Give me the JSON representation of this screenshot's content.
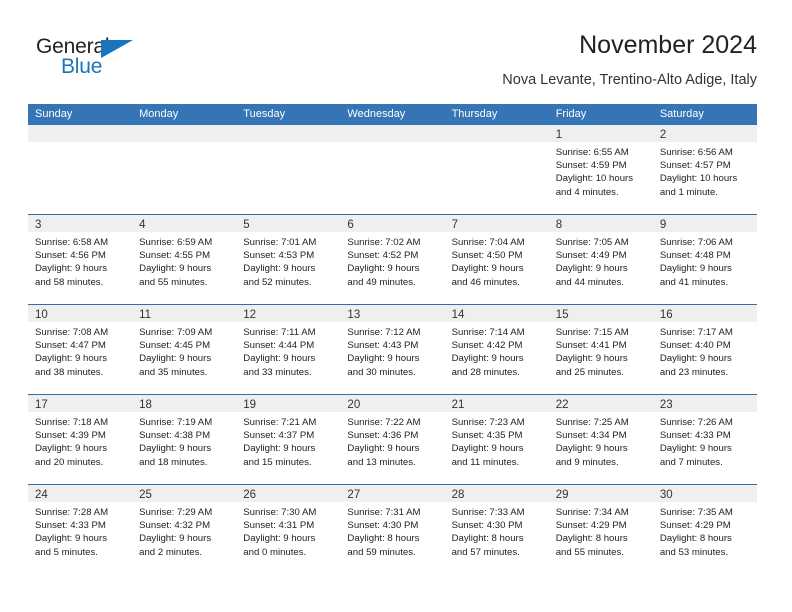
{
  "logo": {
    "word_one": "General",
    "word_two": "Blue",
    "triangle_color": "#1b75bc"
  },
  "header": {
    "title": "November 2024",
    "subtitle": "Nova Levante, Trentino-Alto Adige, Italy"
  },
  "theme": {
    "header_blue": "#3575b5",
    "row_divider_blue": "#2e6da8",
    "day_band_gray": "#efefef"
  },
  "weekdays": [
    "Sunday",
    "Monday",
    "Tuesday",
    "Wednesday",
    "Thursday",
    "Friday",
    "Saturday"
  ],
  "weeks": [
    [
      {
        "day": "",
        "empty": true,
        "sunrise": "",
        "sunset": "",
        "daylight_1": "",
        "daylight_2": ""
      },
      {
        "day": "",
        "empty": true,
        "sunrise": "",
        "sunset": "",
        "daylight_1": "",
        "daylight_2": ""
      },
      {
        "day": "",
        "empty": true,
        "sunrise": "",
        "sunset": "",
        "daylight_1": "",
        "daylight_2": ""
      },
      {
        "day": "",
        "empty": true,
        "sunrise": "",
        "sunset": "",
        "daylight_1": "",
        "daylight_2": ""
      },
      {
        "day": "",
        "empty": true,
        "sunrise": "",
        "sunset": "",
        "daylight_1": "",
        "daylight_2": ""
      },
      {
        "day": "1",
        "empty": false,
        "sunrise": "Sunrise: 6:55 AM",
        "sunset": "Sunset: 4:59 PM",
        "daylight_1": "Daylight: 10 hours",
        "daylight_2": "and 4 minutes."
      },
      {
        "day": "2",
        "empty": false,
        "sunrise": "Sunrise: 6:56 AM",
        "sunset": "Sunset: 4:57 PM",
        "daylight_1": "Daylight: 10 hours",
        "daylight_2": "and 1 minute."
      }
    ],
    [
      {
        "day": "3",
        "empty": false,
        "sunrise": "Sunrise: 6:58 AM",
        "sunset": "Sunset: 4:56 PM",
        "daylight_1": "Daylight: 9 hours",
        "daylight_2": "and 58 minutes."
      },
      {
        "day": "4",
        "empty": false,
        "sunrise": "Sunrise: 6:59 AM",
        "sunset": "Sunset: 4:55 PM",
        "daylight_1": "Daylight: 9 hours",
        "daylight_2": "and 55 minutes."
      },
      {
        "day": "5",
        "empty": false,
        "sunrise": "Sunrise: 7:01 AM",
        "sunset": "Sunset: 4:53 PM",
        "daylight_1": "Daylight: 9 hours",
        "daylight_2": "and 52 minutes."
      },
      {
        "day": "6",
        "empty": false,
        "sunrise": "Sunrise: 7:02 AM",
        "sunset": "Sunset: 4:52 PM",
        "daylight_1": "Daylight: 9 hours",
        "daylight_2": "and 49 minutes."
      },
      {
        "day": "7",
        "empty": false,
        "sunrise": "Sunrise: 7:04 AM",
        "sunset": "Sunset: 4:50 PM",
        "daylight_1": "Daylight: 9 hours",
        "daylight_2": "and 46 minutes."
      },
      {
        "day": "8",
        "empty": false,
        "sunrise": "Sunrise: 7:05 AM",
        "sunset": "Sunset: 4:49 PM",
        "daylight_1": "Daylight: 9 hours",
        "daylight_2": "and 44 minutes."
      },
      {
        "day": "9",
        "empty": false,
        "sunrise": "Sunrise: 7:06 AM",
        "sunset": "Sunset: 4:48 PM",
        "daylight_1": "Daylight: 9 hours",
        "daylight_2": "and 41 minutes."
      }
    ],
    [
      {
        "day": "10",
        "empty": false,
        "sunrise": "Sunrise: 7:08 AM",
        "sunset": "Sunset: 4:47 PM",
        "daylight_1": "Daylight: 9 hours",
        "daylight_2": "and 38 minutes."
      },
      {
        "day": "11",
        "empty": false,
        "sunrise": "Sunrise: 7:09 AM",
        "sunset": "Sunset: 4:45 PM",
        "daylight_1": "Daylight: 9 hours",
        "daylight_2": "and 35 minutes."
      },
      {
        "day": "12",
        "empty": false,
        "sunrise": "Sunrise: 7:11 AM",
        "sunset": "Sunset: 4:44 PM",
        "daylight_1": "Daylight: 9 hours",
        "daylight_2": "and 33 minutes."
      },
      {
        "day": "13",
        "empty": false,
        "sunrise": "Sunrise: 7:12 AM",
        "sunset": "Sunset: 4:43 PM",
        "daylight_1": "Daylight: 9 hours",
        "daylight_2": "and 30 minutes."
      },
      {
        "day": "14",
        "empty": false,
        "sunrise": "Sunrise: 7:14 AM",
        "sunset": "Sunset: 4:42 PM",
        "daylight_1": "Daylight: 9 hours",
        "daylight_2": "and 28 minutes."
      },
      {
        "day": "15",
        "empty": false,
        "sunrise": "Sunrise: 7:15 AM",
        "sunset": "Sunset: 4:41 PM",
        "daylight_1": "Daylight: 9 hours",
        "daylight_2": "and 25 minutes."
      },
      {
        "day": "16",
        "empty": false,
        "sunrise": "Sunrise: 7:17 AM",
        "sunset": "Sunset: 4:40 PM",
        "daylight_1": "Daylight: 9 hours",
        "daylight_2": "and 23 minutes."
      }
    ],
    [
      {
        "day": "17",
        "empty": false,
        "sunrise": "Sunrise: 7:18 AM",
        "sunset": "Sunset: 4:39 PM",
        "daylight_1": "Daylight: 9 hours",
        "daylight_2": "and 20 minutes."
      },
      {
        "day": "18",
        "empty": false,
        "sunrise": "Sunrise: 7:19 AM",
        "sunset": "Sunset: 4:38 PM",
        "daylight_1": "Daylight: 9 hours",
        "daylight_2": "and 18 minutes."
      },
      {
        "day": "19",
        "empty": false,
        "sunrise": "Sunrise: 7:21 AM",
        "sunset": "Sunset: 4:37 PM",
        "daylight_1": "Daylight: 9 hours",
        "daylight_2": "and 15 minutes."
      },
      {
        "day": "20",
        "empty": false,
        "sunrise": "Sunrise: 7:22 AM",
        "sunset": "Sunset: 4:36 PM",
        "daylight_1": "Daylight: 9 hours",
        "daylight_2": "and 13 minutes."
      },
      {
        "day": "21",
        "empty": false,
        "sunrise": "Sunrise: 7:23 AM",
        "sunset": "Sunset: 4:35 PM",
        "daylight_1": "Daylight: 9 hours",
        "daylight_2": "and 11 minutes."
      },
      {
        "day": "22",
        "empty": false,
        "sunrise": "Sunrise: 7:25 AM",
        "sunset": "Sunset: 4:34 PM",
        "daylight_1": "Daylight: 9 hours",
        "daylight_2": "and 9 minutes."
      },
      {
        "day": "23",
        "empty": false,
        "sunrise": "Sunrise: 7:26 AM",
        "sunset": "Sunset: 4:33 PM",
        "daylight_1": "Daylight: 9 hours",
        "daylight_2": "and 7 minutes."
      }
    ],
    [
      {
        "day": "24",
        "empty": false,
        "sunrise": "Sunrise: 7:28 AM",
        "sunset": "Sunset: 4:33 PM",
        "daylight_1": "Daylight: 9 hours",
        "daylight_2": "and 5 minutes."
      },
      {
        "day": "25",
        "empty": false,
        "sunrise": "Sunrise: 7:29 AM",
        "sunset": "Sunset: 4:32 PM",
        "daylight_1": "Daylight: 9 hours",
        "daylight_2": "and 2 minutes."
      },
      {
        "day": "26",
        "empty": false,
        "sunrise": "Sunrise: 7:30 AM",
        "sunset": "Sunset: 4:31 PM",
        "daylight_1": "Daylight: 9 hours",
        "daylight_2": "and 0 minutes."
      },
      {
        "day": "27",
        "empty": false,
        "sunrise": "Sunrise: 7:31 AM",
        "sunset": "Sunset: 4:30 PM",
        "daylight_1": "Daylight: 8 hours",
        "daylight_2": "and 59 minutes."
      },
      {
        "day": "28",
        "empty": false,
        "sunrise": "Sunrise: 7:33 AM",
        "sunset": "Sunset: 4:30 PM",
        "daylight_1": "Daylight: 8 hours",
        "daylight_2": "and 57 minutes."
      },
      {
        "day": "29",
        "empty": false,
        "sunrise": "Sunrise: 7:34 AM",
        "sunset": "Sunset: 4:29 PM",
        "daylight_1": "Daylight: 8 hours",
        "daylight_2": "and 55 minutes."
      },
      {
        "day": "30",
        "empty": false,
        "sunrise": "Sunrise: 7:35 AM",
        "sunset": "Sunset: 4:29 PM",
        "daylight_1": "Daylight: 8 hours",
        "daylight_2": "and 53 minutes."
      }
    ]
  ]
}
